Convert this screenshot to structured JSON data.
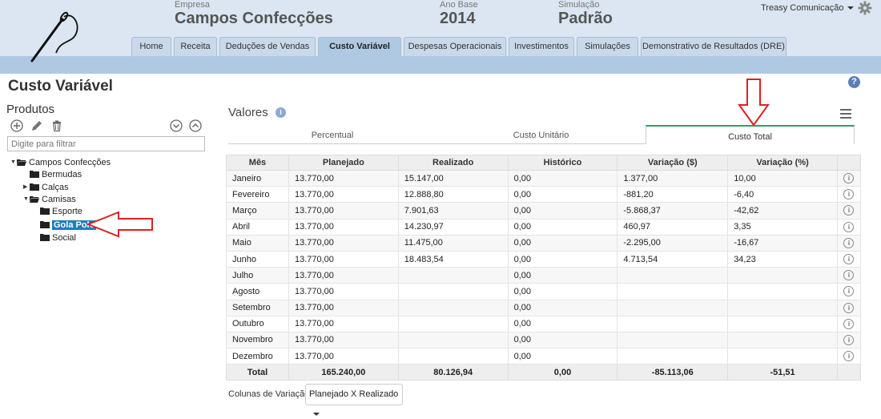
{
  "header": {
    "empresa_label": "Empresa",
    "empresa_value": "Campos Confecções",
    "ano_label": "Ano Base",
    "ano_value": "2014",
    "sim_label": "Simulação",
    "sim_value": "Padrão",
    "user": "Treasy Comunicação"
  },
  "tabs": [
    "Home",
    "Receita",
    "Deduções de Vendas",
    "Custo Variável",
    "Despesas Operacionais",
    "Investimentos",
    "Simulações",
    "Demonstrativo de Resultados (DRE)"
  ],
  "page_title": "Custo Variável",
  "help": "?",
  "sidebar": {
    "title": "Produtos",
    "filter_placeholder": "Digite para filtrar",
    "tree": [
      "Campos Confecções",
      "Bermudas",
      "Calças",
      "Camisas",
      "Esporte",
      "Gola Polo",
      "Social"
    ]
  },
  "panel": {
    "title": "Valores",
    "info": "i",
    "subtabs": [
      "Percentual",
      "Custo Unitário",
      "Custo Total"
    ]
  },
  "table": {
    "headers": [
      "Mês",
      "Planejado",
      "Realizado",
      "Histórico",
      "Variação ($)",
      "Variação (%)"
    ],
    "rows": [
      [
        "Janeiro",
        "13.770,00",
        "15.147,00",
        "0,00",
        "1.377,00",
        "10,00"
      ],
      [
        "Fevereiro",
        "13.770,00",
        "12.888,80",
        "0,00",
        "-881,20",
        "-6,40"
      ],
      [
        "Março",
        "13.770,00",
        "7.901,63",
        "0,00",
        "-5.868,37",
        "-42,62"
      ],
      [
        "Abril",
        "13.770,00",
        "14.230,97",
        "0,00",
        "460,97",
        "3,35"
      ],
      [
        "Maio",
        "13.770,00",
        "11.475,00",
        "0,00",
        "-2.295,00",
        "-16,67"
      ],
      [
        "Junho",
        "13.770,00",
        "18.483,54",
        "0,00",
        "4.713,54",
        "34,23"
      ],
      [
        "Julho",
        "13.770,00",
        "",
        "0,00",
        "",
        ""
      ],
      [
        "Agosto",
        "13.770,00",
        "",
        "0,00",
        "",
        ""
      ],
      [
        "Setembro",
        "13.770,00",
        "",
        "0,00",
        "",
        ""
      ],
      [
        "Outubro",
        "13.770,00",
        "",
        "0,00",
        "",
        ""
      ],
      [
        "Novembro",
        "13.770,00",
        "",
        "0,00",
        "",
        ""
      ],
      [
        "Dezembro",
        "13.770,00",
        "",
        "0,00",
        "",
        ""
      ]
    ],
    "total": [
      "Total",
      "165.240,00",
      "80.126,94",
      "0,00",
      "-85.113,06",
      "-51,51"
    ],
    "info_glyph": "i"
  },
  "footer": {
    "label": "Colunas de Variação:",
    "select_value": "Planejado X Realizado"
  },
  "colors": {
    "header_bg": "#dbe6f2",
    "band": "#b0c9e3",
    "negative": "#2d8a2d",
    "positive": "#d9232d",
    "selected": "#1c7fbf",
    "active_subtab": "#27a36b",
    "annotation": "#e02020"
  }
}
